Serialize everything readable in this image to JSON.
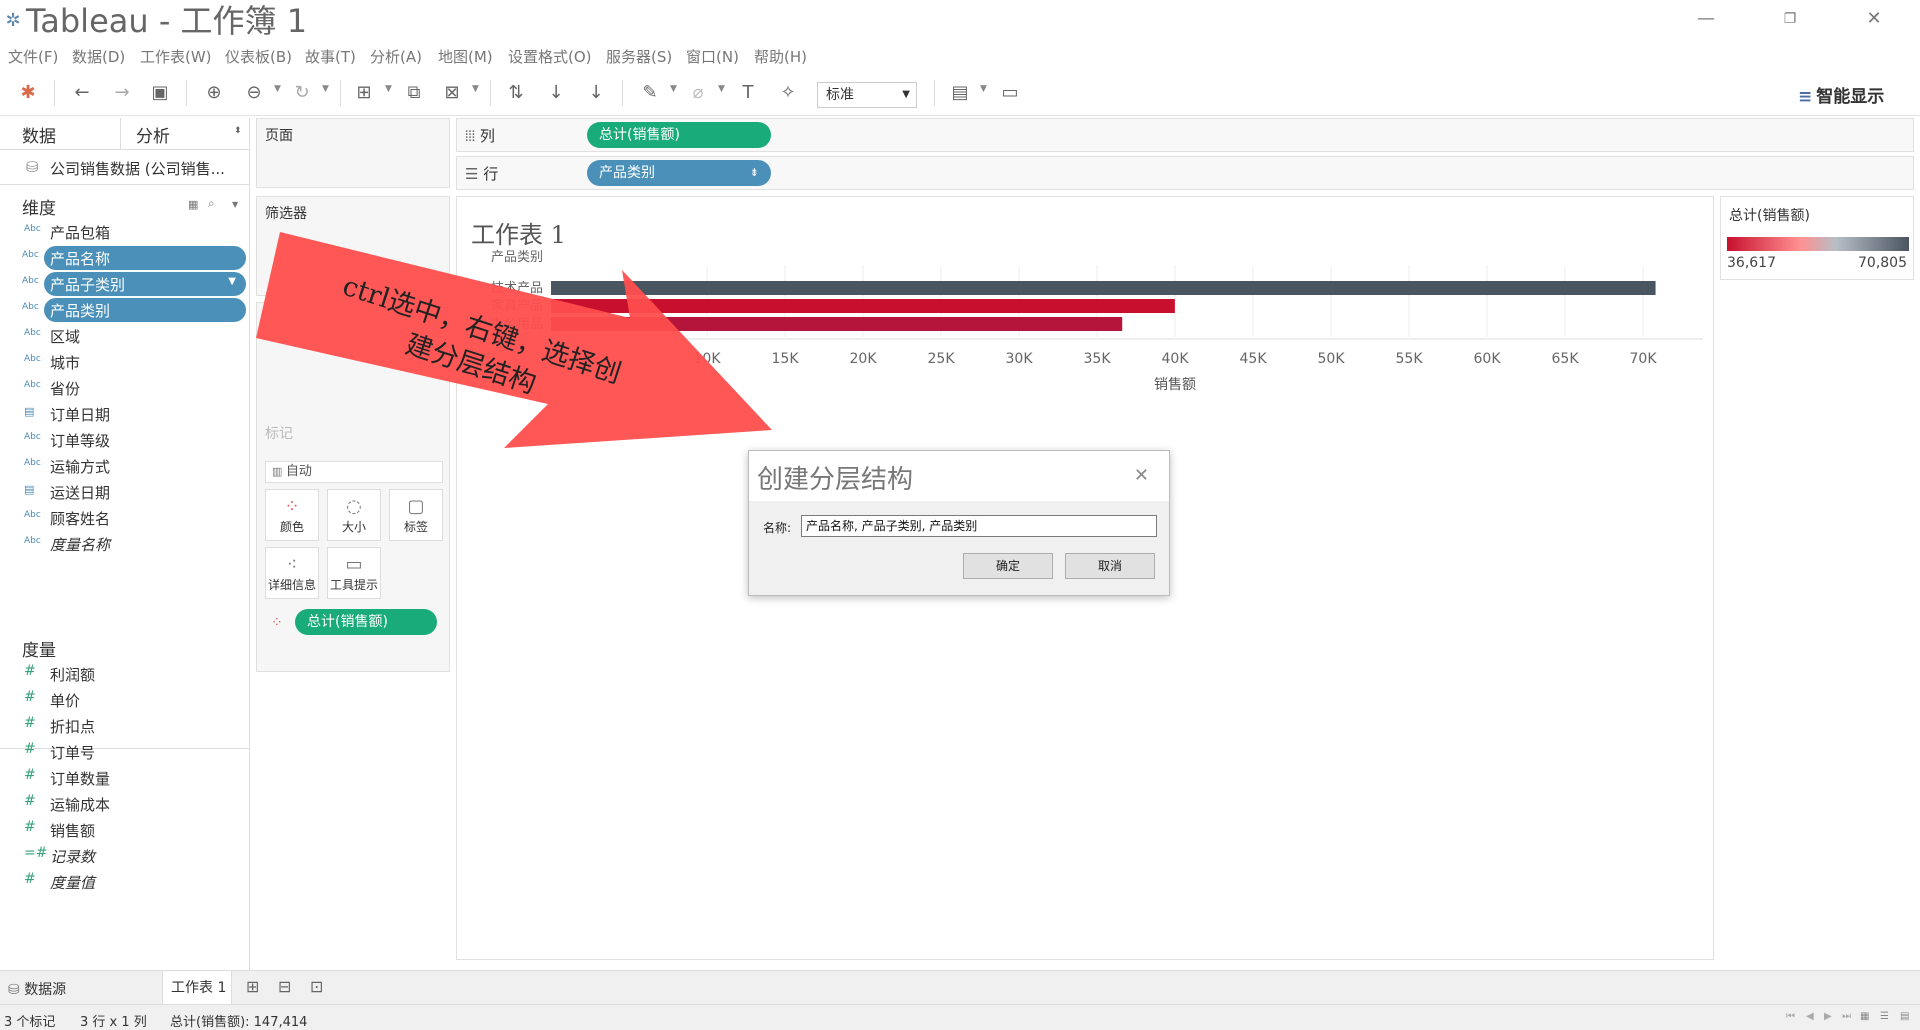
{
  "window": {
    "title": "Tableau - 工作簿 1"
  },
  "menu": [
    "文件(F)",
    "数据(D)",
    "工作表(W)",
    "仪表板(B)",
    "故事(T)",
    "分析(A)",
    "地图(M)",
    "设置格式(O)",
    "服务器(S)",
    "窗口(N)",
    "帮助(H)"
  ],
  "toolbar": {
    "mark_select": "标准",
    "smart_show": "智能显示"
  },
  "data_pane": {
    "tab_data": "数据",
    "tab_analysis": "分析",
    "datasource": "公司销售数据 (公司销售...",
    "dimensions_label": "维度",
    "dimensions": [
      {
        "type": "Abc",
        "label": "产品包箱",
        "selected": false
      },
      {
        "type": "Abc",
        "label": "产品名称",
        "selected": true
      },
      {
        "type": "Abc",
        "label": "产品子类别",
        "selected": true
      },
      {
        "type": "Abc",
        "label": "产品类别",
        "selected": true
      },
      {
        "type": "Abc",
        "label": "区域",
        "selected": false
      },
      {
        "type": "Abc",
        "label": "城市",
        "selected": false
      },
      {
        "type": "Abc",
        "label": "省份",
        "selected": false
      },
      {
        "type": "date",
        "label": "订单日期",
        "selected": false
      },
      {
        "type": "Abc",
        "label": "订单等级",
        "selected": false
      },
      {
        "type": "Abc",
        "label": "运输方式",
        "selected": false
      },
      {
        "type": "date",
        "label": "运送日期",
        "selected": false
      },
      {
        "type": "Abc",
        "label": "顾客姓名",
        "selected": false
      },
      {
        "type": "Abc",
        "label": "度量名称",
        "selected": false
      }
    ],
    "measures_label": "度量",
    "measures": [
      "利润额",
      "单价",
      "折扣点",
      "订单号",
      "订单数量",
      "运输成本",
      "销售额",
      "记录数",
      "度量值"
    ]
  },
  "cards": {
    "pages": "页面",
    "filters": "筛选器",
    "marks": "标记",
    "mark_type": "自动",
    "buttons": [
      "颜色",
      "大小",
      "标签",
      "详细信息",
      "工具提示"
    ],
    "color_pill": "总计(销售额)"
  },
  "shelves": {
    "columns_label": "列",
    "rows_label": "行",
    "columns_pill": "总计(销售额)",
    "rows_pill": "产品类别"
  },
  "view": {
    "sheet_title": "工作表 1"
  },
  "chart_data": {
    "type": "bar",
    "orientation": "horizontal",
    "row_header": "产品类别",
    "categories": [
      "技术产品",
      "家具产品",
      "办公用品"
    ],
    "values": [
      70805,
      39992,
      36617
    ],
    "colors": [
      "#4a5562",
      "#c8102e",
      "#b5153a"
    ],
    "xlabel": "销售额",
    "xlim": [
      0,
      70000
    ],
    "ticks": [
      "10K",
      "15K",
      "20K",
      "25K",
      "30K",
      "35K",
      "40K",
      "45K",
      "50K",
      "55K",
      "60K",
      "65K",
      "70K"
    ],
    "tick_values": [
      10000,
      15000,
      20000,
      25000,
      30000,
      35000,
      40000,
      45000,
      50000,
      55000,
      60000,
      65000,
      70000
    ],
    "grid": true
  },
  "legend": {
    "title": "总计(销售额)",
    "min": "36,617",
    "max": "70,805"
  },
  "dialog": {
    "title": "创建分层结构",
    "name_label": "名称:",
    "name_value": "产品名称, 产品子类别, 产品类别",
    "ok": "确定",
    "cancel": "取消"
  },
  "annotation": {
    "line1": "ctrl选中，右键，选择创",
    "line2": "建分层结构",
    "arrow_color": "#ff4d4d"
  },
  "bottom": {
    "datasource_tab": "数据源",
    "sheet_tab": "工作表 1"
  },
  "status": {
    "marks": "3 个标记",
    "dims": "3 行 x 1 列",
    "sum": "总计(销售额): 147,414"
  }
}
